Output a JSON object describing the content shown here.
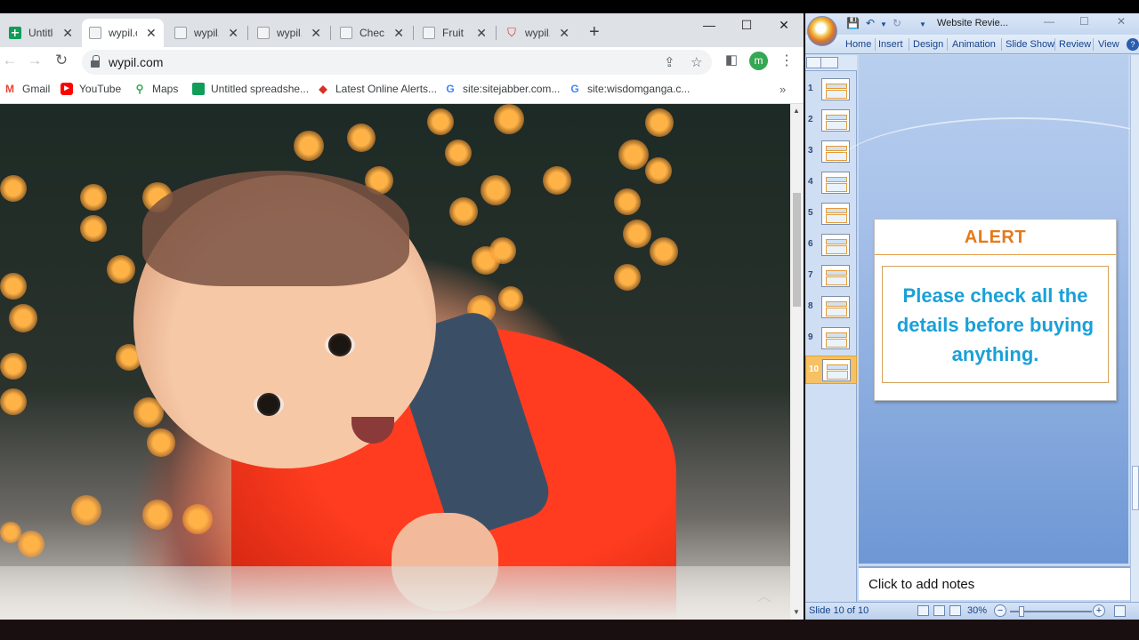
{
  "chrome": {
    "tabs": [
      {
        "label": "Untitled spreadsheet",
        "icon": "sheets-icon",
        "active": false
      },
      {
        "label": "wypil.com",
        "icon": "page-icon",
        "active": true
      },
      {
        "label": "wypil.com",
        "icon": "page-icon",
        "active": false
      },
      {
        "label": "wypil.com",
        "icon": "page-icon",
        "active": false
      },
      {
        "label": "Check",
        "icon": "page-icon",
        "active": false
      },
      {
        "label": "Fruit P",
        "icon": "page-icon",
        "active": false
      },
      {
        "label": "wypil.c",
        "icon": "shield-icon",
        "active": false
      }
    ],
    "url": "wypil.com",
    "profile_initial": "m",
    "bookmarks": [
      {
        "label": "Gmail",
        "icon": "gmail-icon"
      },
      {
        "label": "YouTube",
        "icon": "youtube-icon"
      },
      {
        "label": "Maps",
        "icon": "maps-icon"
      },
      {
        "label": "Untitled spreadshe...",
        "icon": "sheets-icon"
      },
      {
        "label": "Latest Online Alerts...",
        "icon": "alert-icon"
      },
      {
        "label": "site:sitejabber.com...",
        "icon": "google-icon"
      },
      {
        "label": "site:wisdomganga.c...",
        "icon": "google-icon"
      }
    ]
  },
  "ppt": {
    "doc_title": "Website Revie...",
    "ribbon_tabs": [
      "Home",
      "Insert",
      "Design",
      "Animation",
      "Slide Show",
      "Review",
      "View"
    ],
    "thumb_numbers": [
      "1",
      "2",
      "3",
      "4",
      "5",
      "6",
      "7",
      "8",
      "9",
      "10"
    ],
    "selected_slide": 10,
    "slide": {
      "heading": "ALERT",
      "body": "Please check all the details before buying anything."
    },
    "notes_placeholder": "Click to add notes",
    "status": "Slide 10 of 10",
    "zoom": "30%",
    "colors": {
      "heading": "#e47a1a",
      "body": "#1aa0d8"
    }
  }
}
